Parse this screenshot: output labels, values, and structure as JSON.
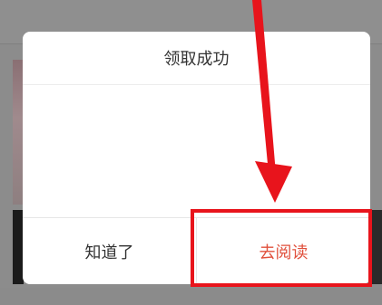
{
  "dialog": {
    "title": "领取成功",
    "dismiss_label": "知道了",
    "read_label": "去阅读"
  },
  "colors": {
    "overlay": "#8c8c8c",
    "accent": "#e0503c",
    "annotation": "#e8141c"
  },
  "annotations": {
    "highlight_target": "read-button",
    "arrow_icon": "arrow-down-icon"
  }
}
